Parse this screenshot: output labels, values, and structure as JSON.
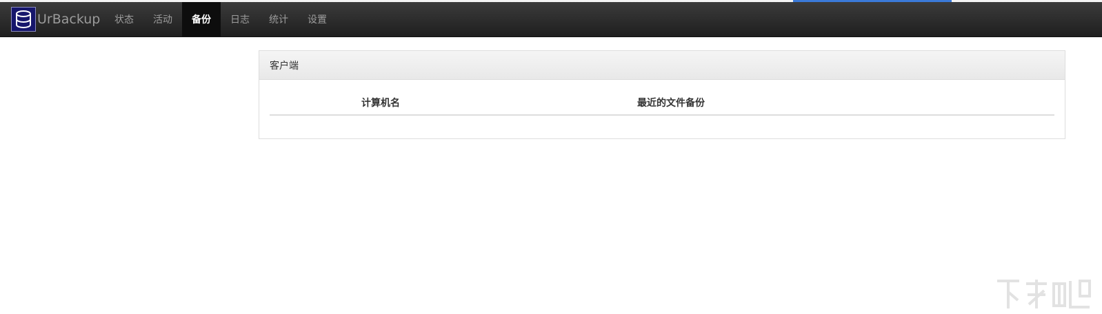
{
  "app": {
    "brand_name": "UrBackup",
    "accent_color": "#3b7ad9",
    "logo_icon": "database-icon"
  },
  "nav": {
    "items": [
      {
        "label": "状态"
      },
      {
        "label": "活动"
      },
      {
        "label": "备份",
        "active": true
      },
      {
        "label": "日志"
      },
      {
        "label": "统计"
      },
      {
        "label": "设置"
      }
    ]
  },
  "clients_panel": {
    "title": "客户端",
    "columns": [
      "计算机名",
      "最近的文件备份"
    ]
  }
}
